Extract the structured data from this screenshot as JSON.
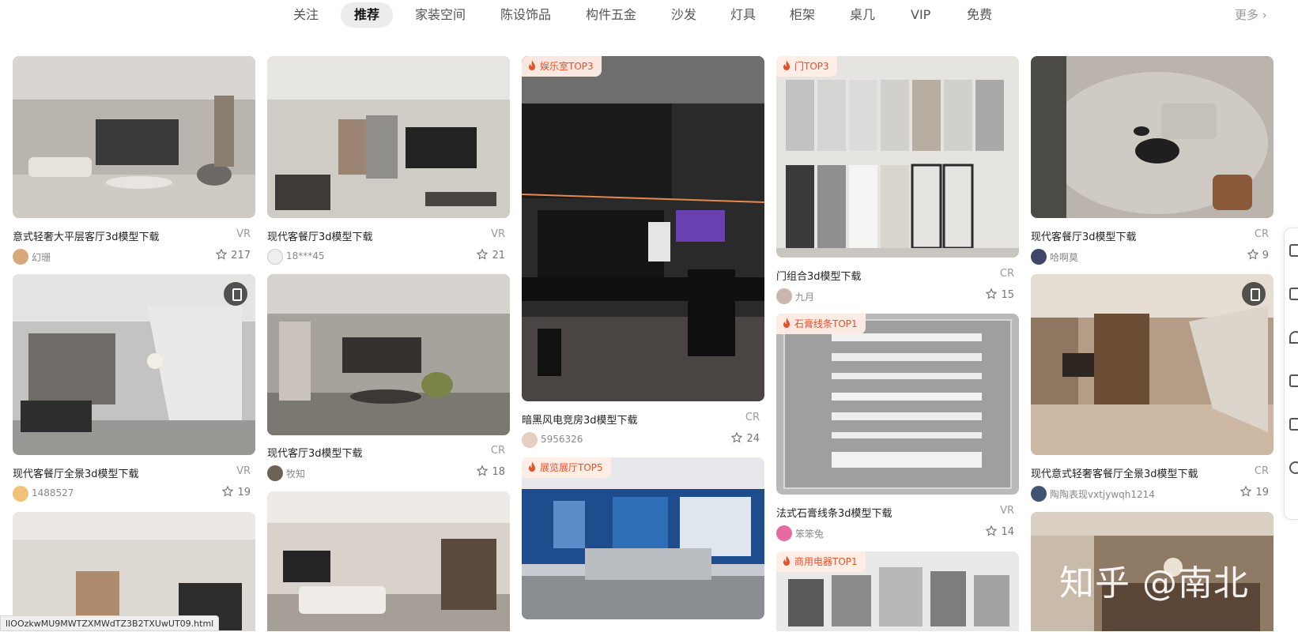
{
  "tabs": [
    {
      "label": "关注",
      "active": false
    },
    {
      "label": "推荐",
      "active": true
    },
    {
      "label": "家装空间",
      "active": false
    },
    {
      "label": "陈设饰品",
      "active": false
    },
    {
      "label": "构件五金",
      "active": false
    },
    {
      "label": "沙发",
      "active": false
    },
    {
      "label": "灯具",
      "active": false
    },
    {
      "label": "柜架",
      "active": false
    },
    {
      "label": "桌几",
      "active": false
    },
    {
      "label": "VIP",
      "active": false
    },
    {
      "label": "免费",
      "active": false
    }
  ],
  "more_label": "更多 ›",
  "cards": [
    {
      "title": "意式轻奢大平层客厅3d模型下载",
      "tag": "VR",
      "author": "幻珊",
      "likes": "217"
    },
    {
      "title": "现代客餐厅全景3d模型下载",
      "tag": "VR",
      "author": "1488527",
      "likes": "19"
    },
    {
      "title": "现代客餐厅3d模型下载",
      "tag": "VR",
      "author": "18***45",
      "likes": "21"
    },
    {
      "title": "现代客厅3d模型下载",
      "tag": "CR",
      "author": "牧知",
      "likes": "18"
    },
    {
      "badge": "娱乐室TOP3",
      "title": "暗黑风电竞房3d模型下载",
      "tag": "CR",
      "author": "5956326",
      "likes": "24"
    },
    {
      "badge": "展览展厅TOP5"
    },
    {
      "badge": "门TOP3",
      "title": "门组合3d模型下载",
      "tag": "CR",
      "author": "九月",
      "likes": "15"
    },
    {
      "badge": "石膏线条TOP1",
      "title": "法式石膏线条3d模型下载",
      "tag": "VR",
      "author": "笨笨兔",
      "likes": "14"
    },
    {
      "badge": "商用电器TOP1"
    },
    {
      "title": "现代客餐厅3d模型下载",
      "tag": "CR",
      "author": "哈啊莫",
      "likes": "9"
    },
    {
      "title": "现代意式轻奢客餐厅全景3d模型下载",
      "tag": "CR",
      "author": "陶陶表现vxtjywqh1214",
      "likes": "19"
    }
  ],
  "status_url": "lIOOzkwMU9MWTZXMWdTZ3B2TXUwUT09.html",
  "watermark": "知乎 @南北",
  "colors": {
    "accent": "#e8502a",
    "active_tab_bg": "#ececec"
  }
}
